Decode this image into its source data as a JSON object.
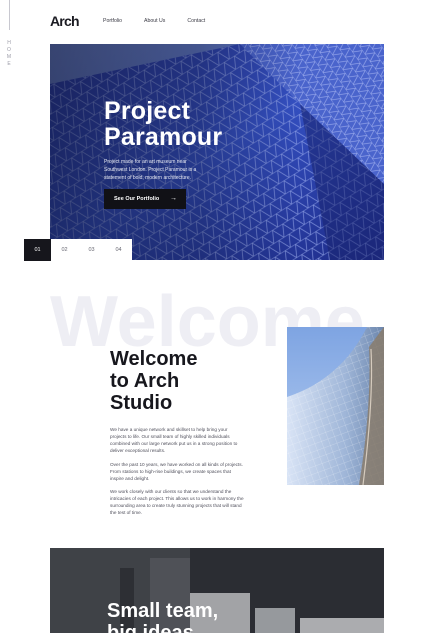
{
  "side_rail": {
    "label": "HOME"
  },
  "header": {
    "logo": "Arch",
    "nav": [
      "Portfolio",
      "About Us",
      "Contact"
    ]
  },
  "hero": {
    "title_line1": "Project",
    "title_line2": "Paramour",
    "description": "Project made for an art museum near Southwest London. Project Paramour is a statement of bold, modern architecture.",
    "cta_label": "See Our Portfolio",
    "cta_arrow": "→"
  },
  "pager": [
    "01",
    "02",
    "03",
    "04"
  ],
  "welcome": {
    "ghost_word": "Welcome",
    "title_line1": "Welcome",
    "title_line2": "to Arch",
    "title_line3": "Studio",
    "paragraphs": [
      "We have a unique network and skillset to help bring your projects to life. Our small team of highly skilled individuals combined with our large network put us in a strong position to deliver exceptional results.",
      "Over the past 10 years, we have worked on all kinds of projects. From stations to high-rise buildings, we create spaces that inspire and delight.",
      "We work closely with our clients so that we understand the intricacies of each project. This allows us to work in harmony the surrounding area to create truly stunning projects that will stand the test of time."
    ]
  },
  "band": {
    "title_line1": "Small team,",
    "title_line2": "big ideas."
  },
  "colors": {
    "dark": "#16161c",
    "hero_blue": "#2d3f9a",
    "ghost": "#eeeef4"
  }
}
